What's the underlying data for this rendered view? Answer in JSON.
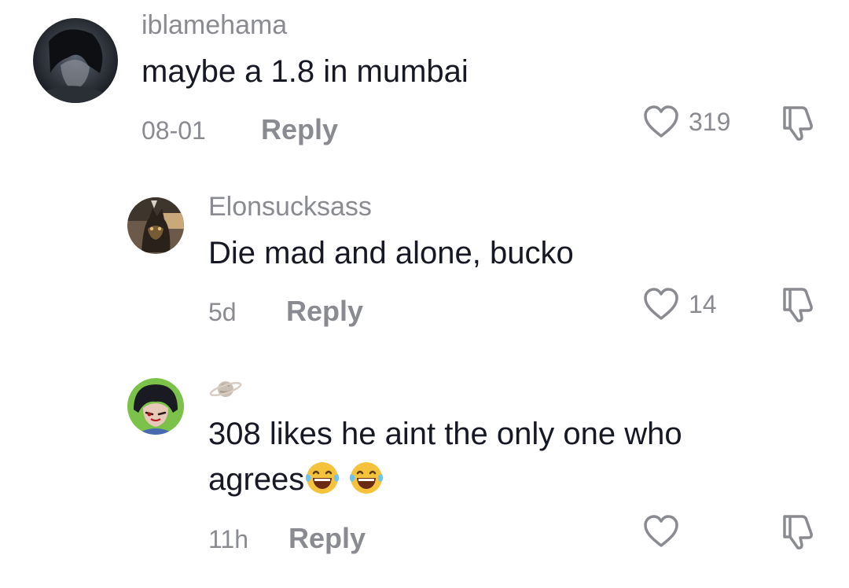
{
  "comments": [
    {
      "username": "iblamehama",
      "text": "maybe a 1.8 in mumbai",
      "time": "08-01",
      "reply_label": "Reply",
      "like_count": "319",
      "avatar_icon": "dark-anime-avatar"
    },
    {
      "username": "Elonsucksass",
      "text": "Die mad and alone, bucko",
      "time": "5d",
      "reply_label": "Reply",
      "like_count": "14",
      "avatar_icon": "cat-avatar"
    },
    {
      "username_icon": "ringed-planet-emoji",
      "text_line1": "308 likes he aint the only one who",
      "text_line2": "agrees",
      "text_emojis": [
        "laughing-crying-emoji",
        "laughing-crying-emoji"
      ],
      "time": "11h",
      "reply_label": "Reply",
      "like_count": "",
      "avatar_icon": "anime-character-avatar"
    }
  ],
  "colors": {
    "primary_text": "#161823",
    "secondary_text": "#8a8b91",
    "icon_stroke": "#8a8b91",
    "background": "#ffffff"
  }
}
